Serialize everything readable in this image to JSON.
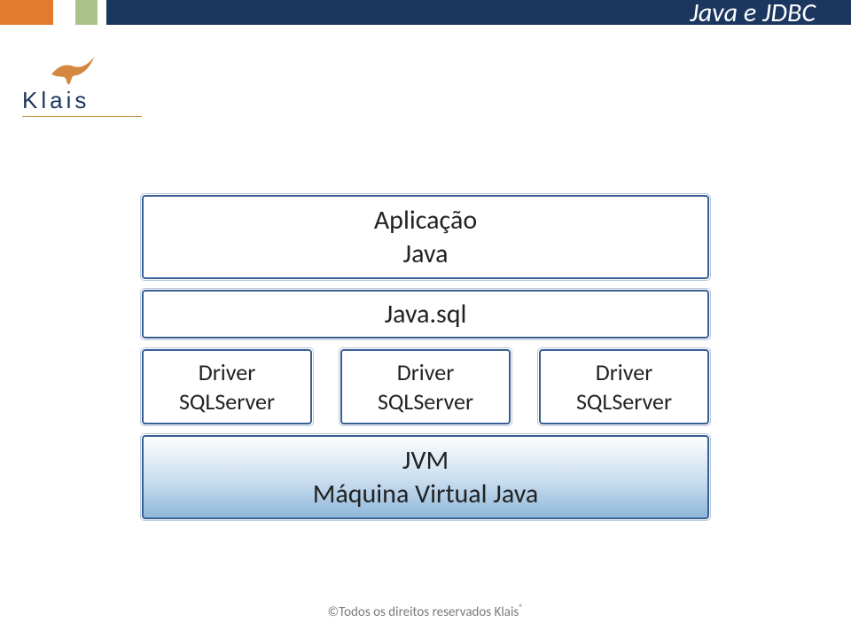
{
  "header": {
    "title": "Java e JDBC"
  },
  "logo": {
    "text": "Klais"
  },
  "diagram": {
    "application": {
      "line1": "Aplicação",
      "line2": "Java"
    },
    "javasql": "Java.sql",
    "drivers": [
      {
        "line1": "Driver",
        "line2": "SQLServer"
      },
      {
        "line1": "Driver",
        "line2": "SQLServer"
      },
      {
        "line1": "Driver",
        "line2": "SQLServer"
      }
    ],
    "jvm": {
      "line1": "JVM",
      "line2": "Máquina Virtual Java"
    }
  },
  "footer": {
    "text": "©Todos os direitos reservados Klais",
    "reg": "®"
  }
}
